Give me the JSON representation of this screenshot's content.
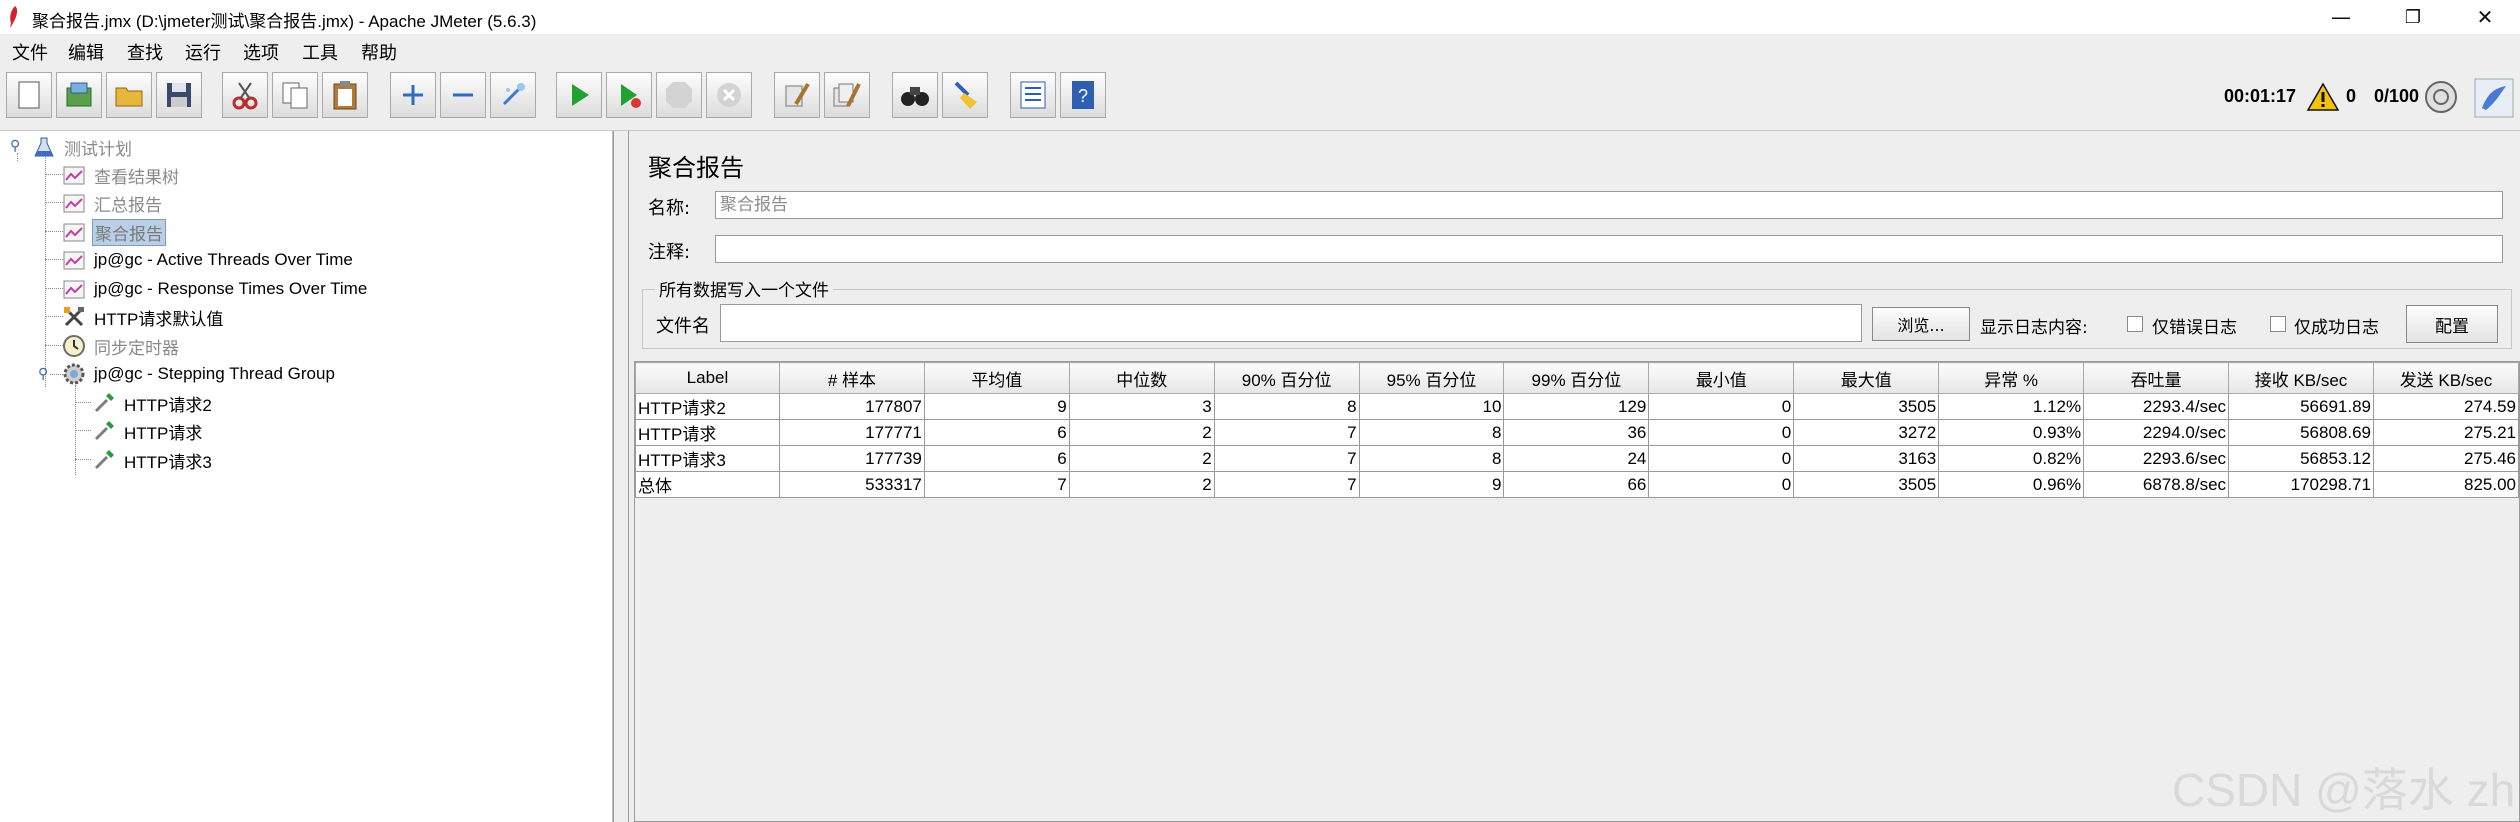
{
  "window": {
    "title": "聚合报告.jmx (D:\\jmeter测试\\聚合报告.jmx) - Apache JMeter (5.6.3)",
    "controls": [
      "—",
      "❐",
      "✕"
    ]
  },
  "menu": [
    "文件",
    "编辑",
    "查找",
    "运行",
    "选项",
    "工具",
    "帮助"
  ],
  "toolbar": {
    "buttons": [
      "new-icon",
      "templates-icon",
      "open-icon",
      "save-icon",
      "cut-icon",
      "copy-icon",
      "paste-icon",
      "expand-icon",
      "collapse-icon",
      "toggle-icon",
      "start-icon",
      "start-no-pause-icon",
      "stop-icon",
      "shutdown-icon",
      "clear-icon",
      "clear-all-icon",
      "search-icon",
      "reset-search-icon",
      "function-helper-icon",
      "help-icon"
    ],
    "status_time": "00:01:17",
    "warning_count": "0",
    "threads": "0/100"
  },
  "tree": {
    "items": [
      {
        "label": "测试计划",
        "icon": "test-plan-icon"
      },
      {
        "label": "查看结果树",
        "icon": "listener-icon"
      },
      {
        "label": "汇总报告",
        "icon": "listener-icon"
      },
      {
        "label": "聚合报告",
        "icon": "listener-icon"
      },
      {
        "label": "jp@gc - Active Threads Over Time",
        "icon": "listener-icon"
      },
      {
        "label": "jp@gc - Response Times Over Time",
        "icon": "listener-icon"
      },
      {
        "label": "HTTP请求默认值",
        "icon": "config-tools-icon"
      },
      {
        "label": "同步定时器",
        "icon": "timer-icon"
      },
      {
        "label": "jp@gc - Stepping Thread Group",
        "icon": "thread-group-gear-icon"
      },
      {
        "label": "HTTP请求2",
        "icon": "sampler-pipette-icon"
      },
      {
        "label": "HTTP请求",
        "icon": "sampler-pipette-icon"
      },
      {
        "label": "HTTP请求3",
        "icon": "sampler-pipette-icon"
      }
    ]
  },
  "panel": {
    "title": "聚合报告",
    "name_label": "名称:",
    "name_value": "聚合报告",
    "comment_label": "注释:",
    "comment_value": "",
    "file_section_legend": "所有数据写入一个文件",
    "filename_label": "文件名",
    "filename_value": "",
    "browse_button": "浏览...",
    "log_display_label": "显示日志内容:",
    "errors_only_label": "仅错误日志",
    "success_only_label": "仅成功日志",
    "configure_button": "配置"
  },
  "table": {
    "columns": [
      "Label",
      "# 样本",
      "平均值",
      "中位数",
      "90% 百分位",
      "95% 百分位",
      "99% 百分位",
      "最小值",
      "最大值",
      "异常 %",
      "吞吐量",
      "接收 KB/sec",
      "发送 KB/sec"
    ],
    "rows": [
      [
        "HTTP请求2",
        "177807",
        "9",
        "3",
        "8",
        "10",
        "129",
        "0",
        "3505",
        "1.12%",
        "2293.4/sec",
        "56691.89",
        "274.59"
      ],
      [
        "HTTP请求",
        "177771",
        "6",
        "2",
        "7",
        "8",
        "36",
        "0",
        "3272",
        "0.93%",
        "2294.0/sec",
        "56808.69",
        "275.21"
      ],
      [
        "HTTP请求3",
        "177739",
        "6",
        "2",
        "7",
        "8",
        "24",
        "0",
        "3163",
        "0.82%",
        "2293.6/sec",
        "56853.12",
        "275.46"
      ],
      [
        "总体",
        "533317",
        "7",
        "2",
        "7",
        "9",
        "66",
        "0",
        "3505",
        "0.96%",
        "6878.8/sec",
        "170298.71",
        "825.00"
      ]
    ]
  },
  "watermark": "CSDN @落水 zh"
}
